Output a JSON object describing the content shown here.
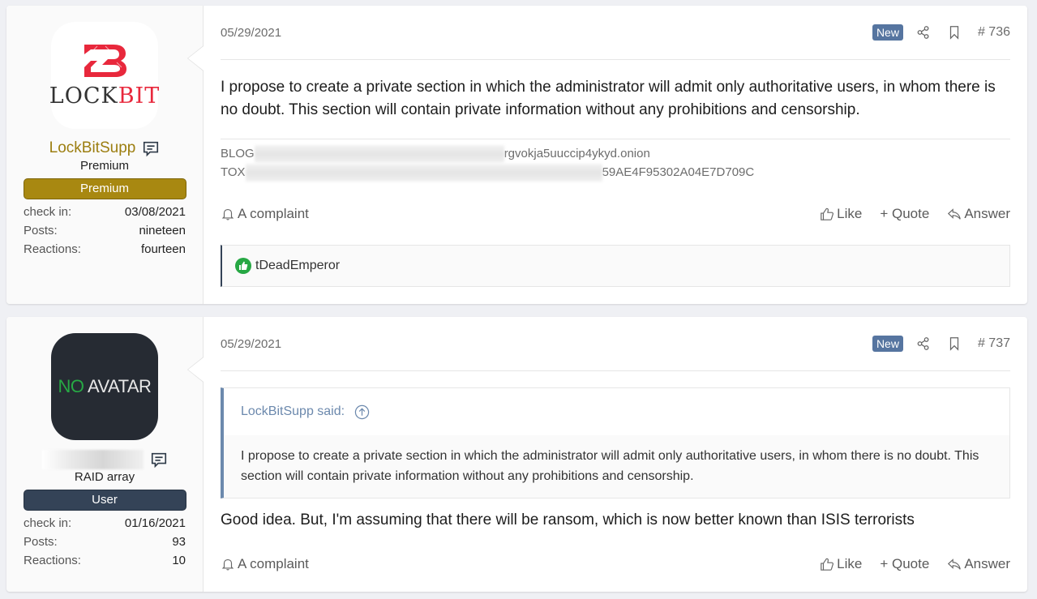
{
  "posts": [
    {
      "user": {
        "avatar_type": "lockbit-logo",
        "avatar_text_dark": "LOCK",
        "avatar_text_red": "BIT",
        "username": "LockBitSupp",
        "username_color": "#9c7e10",
        "user_title": "Premium",
        "banner": "Premium",
        "banner_color": "#a88811",
        "stats": [
          {
            "label": "check in:",
            "value": "03/08/2021"
          },
          {
            "label": "Posts:",
            "value": "nineteen"
          },
          {
            "label": "Reactions:",
            "value": "fourteen"
          }
        ]
      },
      "date": "05/29/2021",
      "badge": "New",
      "post_number": "# 736",
      "body": "I propose to create a private section in which the administrator will admit only authoritative users, in whom there is no doubt. This section will contain private information without any prohibitions and censorship.",
      "signature": [
        {
          "label": "BLOG",
          "visible_tail": "rgvokja5uuccip4ykyd.onion"
        },
        {
          "label": "TOX",
          "visible_tail": "59AE4F95302A04E7D709C"
        }
      ],
      "actions": {
        "report": "A complaint",
        "like": "Like",
        "quote": "+ Quote",
        "reply": "Answer"
      },
      "reactions": {
        "icon": "thumbs-up-green",
        "users": "tDeadEmperor"
      }
    },
    {
      "user": {
        "avatar_type": "no-avatar",
        "avatar_text_green": "NO",
        "avatar_text_light": "AVATAR",
        "username": "[redacted]",
        "user_title": "RAID array",
        "banner": "User",
        "banner_color": "#344357",
        "stats": [
          {
            "label": "check in:",
            "value": "01/16/2021"
          },
          {
            "label": "Posts:",
            "value": "93"
          },
          {
            "label": "Reactions:",
            "value": "10"
          }
        ]
      },
      "date": "05/29/2021",
      "badge": "New",
      "post_number": "# 737",
      "quote": {
        "author": "LockBitSupp said:",
        "text": "I propose to create a private section in which the administrator will admit only authoritative users, in whom there is no doubt. This section will contain private information without any prohibitions and censorship."
      },
      "body": "Good idea. But, I'm assuming that there will be ransom, which is now better known than ISIS terrorists",
      "actions": {
        "report": "A complaint",
        "like": "Like",
        "quote": "+ Quote",
        "reply": "Answer"
      }
    }
  ],
  "colors": {
    "accent": "#5675a0",
    "quote_border": "#6c89ad",
    "premium": "#a88811",
    "user_banner": "#344357",
    "lockbit_red": "#e8283c"
  }
}
